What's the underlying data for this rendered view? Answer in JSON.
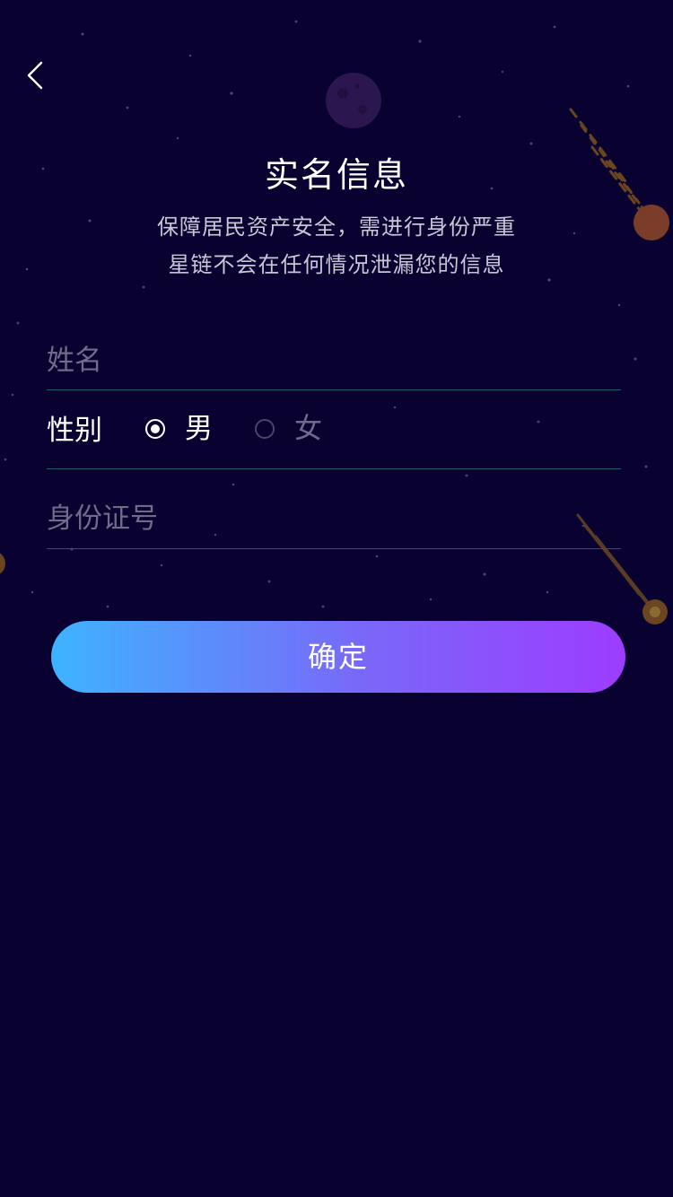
{
  "header": {
    "title": "实名信息",
    "subtitle_lines": [
      "保障居民资产安全，需进行身份严重",
      "星链不会在任何情况泄漏您的信息"
    ]
  },
  "form": {
    "name": {
      "placeholder": "姓名",
      "value": ""
    },
    "gender": {
      "label": "性别",
      "options": [
        {
          "label": "男",
          "selected": true
        },
        {
          "label": "女",
          "selected": false
        }
      ]
    },
    "id_number": {
      "placeholder": "身份证号",
      "value": ""
    }
  },
  "actions": {
    "confirm_label": "确定"
  },
  "icons": {
    "back": "chevron-left-icon"
  },
  "colors": {
    "background": "#090130",
    "button_gradient_start": "#3eb3ff",
    "button_gradient_end": "#9d3cff",
    "divider": "#1f5a6e"
  }
}
